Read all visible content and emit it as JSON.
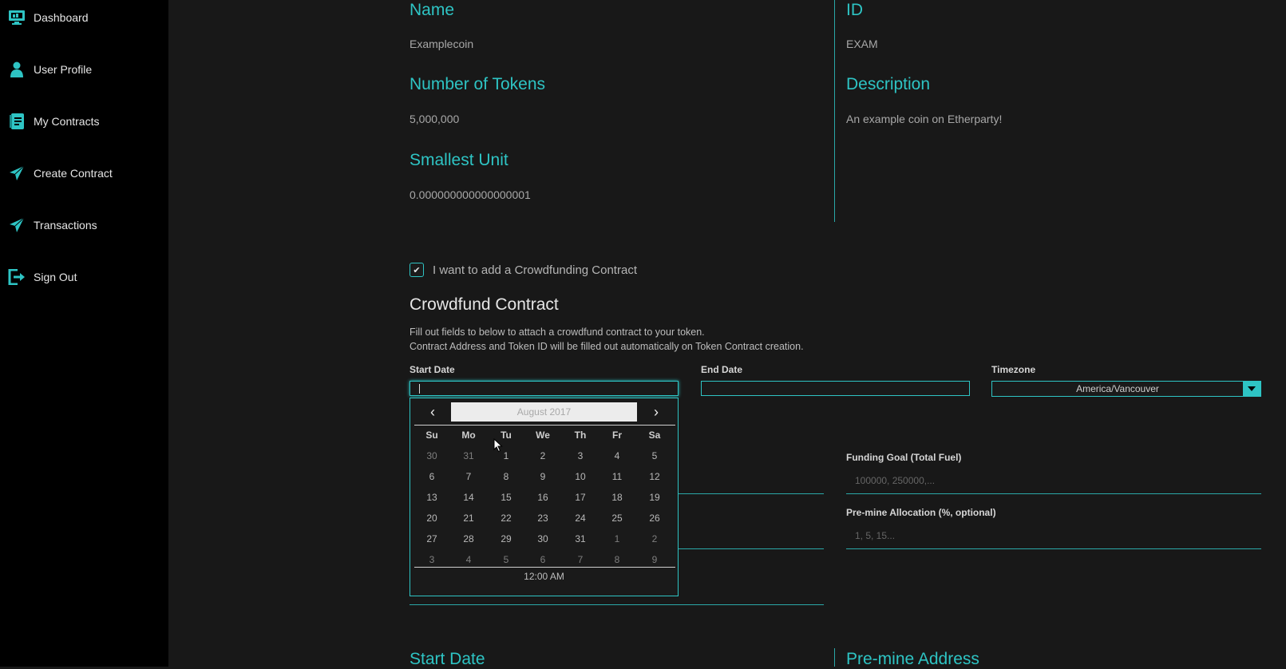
{
  "sidebar": {
    "items": [
      {
        "label": "Dashboard",
        "icon": "dashboard-icon"
      },
      {
        "label": "User Profile",
        "icon": "user-icon"
      },
      {
        "label": "My Contracts",
        "icon": "contracts-icon"
      },
      {
        "label": "Create Contract",
        "icon": "send-icon"
      },
      {
        "label": "Transactions",
        "icon": "send-icon"
      },
      {
        "label": "Sign Out",
        "icon": "sign-out-icon"
      }
    ]
  },
  "token": {
    "name_label": "Name",
    "name_value": "Examplecoin",
    "id_label": "ID",
    "id_value": "EXAM",
    "tokens_label": "Number of Tokens",
    "tokens_value": "5,000,000",
    "description_label": "Description",
    "description_value": "An example coin on Etherparty!",
    "unit_label": "Smallest Unit",
    "unit_value": "0.000000000000000001"
  },
  "crowdfund": {
    "checkbox_label": "I want to add a Crowdfunding Contract",
    "checkbox_checked": true,
    "title": "Crowdfund Contract",
    "desc_line1": "Fill out fields to below to attach a crowdfund contract to your token.",
    "desc_line2": "Contract Address and Token ID will be filled out automatically on Token Contract creation.",
    "start_date_label": "Start Date",
    "end_date_label": "End Date",
    "timezone_label": "Timezone",
    "timezone_value": "America/Vancouver",
    "funding_goal_label": "Funding Goal (Total Fuel)",
    "funding_goal_placeholder": "100000, 250000,...",
    "premine_label": "Pre-mine Allocation (%, optional)",
    "premine_placeholder": "1, 5, 15...",
    "bottom_start_date_label": "Start Date",
    "bottom_premine_address_label": "Pre-mine Address"
  },
  "datepicker": {
    "month": "August 2017",
    "prev": "‹",
    "next": "›",
    "weekdays": [
      "Su",
      "Mo",
      "Tu",
      "We",
      "Th",
      "Fr",
      "Sa"
    ],
    "weeks": [
      [
        "30",
        "31",
        "1",
        "2",
        "3",
        "4",
        "5"
      ],
      [
        "6",
        "7",
        "8",
        "9",
        "10",
        "11",
        "12"
      ],
      [
        "13",
        "14",
        "15",
        "16",
        "17",
        "18",
        "19"
      ],
      [
        "20",
        "21",
        "22",
        "23",
        "24",
        "25",
        "26"
      ],
      [
        "27",
        "28",
        "29",
        "30",
        "31",
        "1",
        "2"
      ],
      [
        "3",
        "4",
        "5",
        "6",
        "7",
        "8",
        "9"
      ]
    ],
    "time": "12:00 AM"
  },
  "colors": {
    "accent": "#2ec4c4",
    "sidebar_bg": "#000000",
    "page_bg": "#181818"
  }
}
